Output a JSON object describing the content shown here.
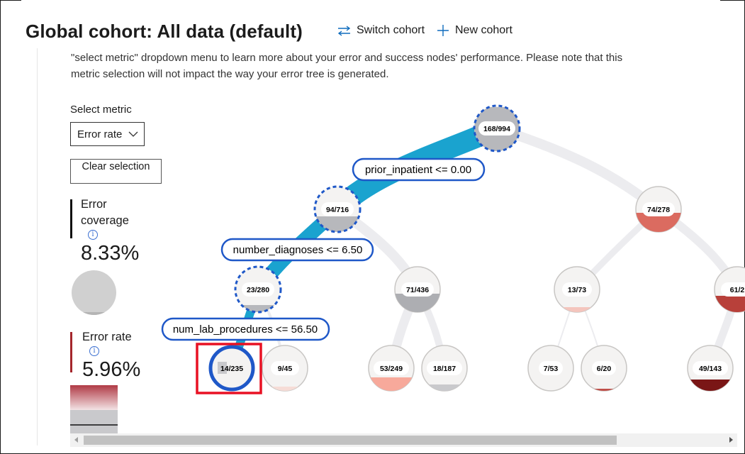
{
  "header": {
    "title": "Global cohort: All data (default)",
    "switch_cohort": "Switch cohort",
    "new_cohort": "New cohort"
  },
  "description": {
    "line1": "\"select metric\" dropdown menu to learn more about your error and success nodes' performance. Please note that this",
    "line2": "metric selection will not impact the way your error tree is generated."
  },
  "controls": {
    "select_metric_label": "Select metric",
    "select_metric_value": "Error rate",
    "clear_selection": "Clear selection"
  },
  "metrics": {
    "coverage_label_1": "Error",
    "coverage_label_2": "coverage",
    "coverage_value": "8.33%",
    "coverage_fraction": 0.0833,
    "error_rate_label": "Error rate",
    "error_rate_value": "5.96%",
    "error_rate_fraction": 0.0596
  },
  "colors": {
    "accent": "#0f6cbd",
    "selected_path": "#1aa3cf",
    "highlight_box": "#e81123",
    "error_red": "#a4262c"
  },
  "tree": {
    "nodes": [
      {
        "id": "root",
        "label": "168/994",
        "error_rate": 0.169
      },
      {
        "id": "n1",
        "label": "94/716",
        "error_rate": 0.131
      },
      {
        "id": "n2",
        "label": "74/278",
        "error_rate": 0.266
      },
      {
        "id": "n3",
        "label": "23/280",
        "error_rate": 0.082
      },
      {
        "id": "n4",
        "label": "71/436",
        "error_rate": 0.163
      },
      {
        "id": "n5",
        "label": "13/73",
        "error_rate": 0.178
      },
      {
        "id": "n6",
        "label": "61/2",
        "error_rate": 0.3
      },
      {
        "id": "n7",
        "label": "14/235",
        "error_rate": 0.06
      },
      {
        "id": "n8",
        "label": "9/45",
        "error_rate": 0.2
      },
      {
        "id": "n9",
        "label": "53/249",
        "error_rate": 0.213
      },
      {
        "id": "n10",
        "label": "18/187",
        "error_rate": 0.096
      },
      {
        "id": "n11",
        "label": "7/53",
        "error_rate": 0.132
      },
      {
        "id": "n12",
        "label": "6/20",
        "error_rate": 0.3
      },
      {
        "id": "n13",
        "label": "49/143",
        "error_rate": 0.343
      }
    ],
    "conditions": [
      "prior_inpatient <= 0.00",
      "number_diagnoses <= 6.50",
      "num_lab_procedures <= 56.50"
    ]
  }
}
